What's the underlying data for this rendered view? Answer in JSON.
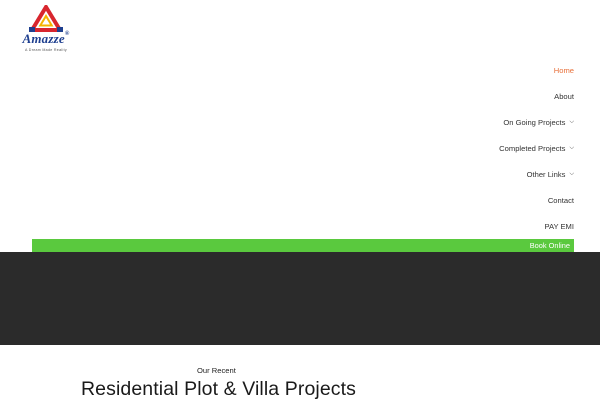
{
  "brand": {
    "name": "Amazze",
    "registered_mark": "®",
    "tagline": "A Dream Made Reality",
    "colors": {
      "triangle_red": "#d8262e",
      "triangle_yellow": "#f5b400",
      "triangle_blue": "#1e3f8f",
      "wordmark": "#1e3f8f"
    }
  },
  "nav": {
    "items": [
      {
        "label": "Home",
        "active": true,
        "has_dropdown": false
      },
      {
        "label": "About",
        "active": false,
        "has_dropdown": false
      },
      {
        "label": "On Going Projects",
        "active": false,
        "has_dropdown": true
      },
      {
        "label": "Completed Projects",
        "active": false,
        "has_dropdown": true
      },
      {
        "label": "Other Links",
        "active": false,
        "has_dropdown": true
      },
      {
        "label": "Contact",
        "active": false,
        "has_dropdown": false
      },
      {
        "label": "PAY EMI",
        "active": false,
        "has_dropdown": false
      }
    ],
    "active_color": "#e8703a",
    "dropdown_icon": "chevron-down-icon"
  },
  "book_online": {
    "label": "Book Online",
    "background": "#5ac93e"
  },
  "banner": {
    "background": "#2b2b2b"
  },
  "section": {
    "eyebrow": "Our Recent",
    "title": "Residential Plot & Villa Projects"
  }
}
